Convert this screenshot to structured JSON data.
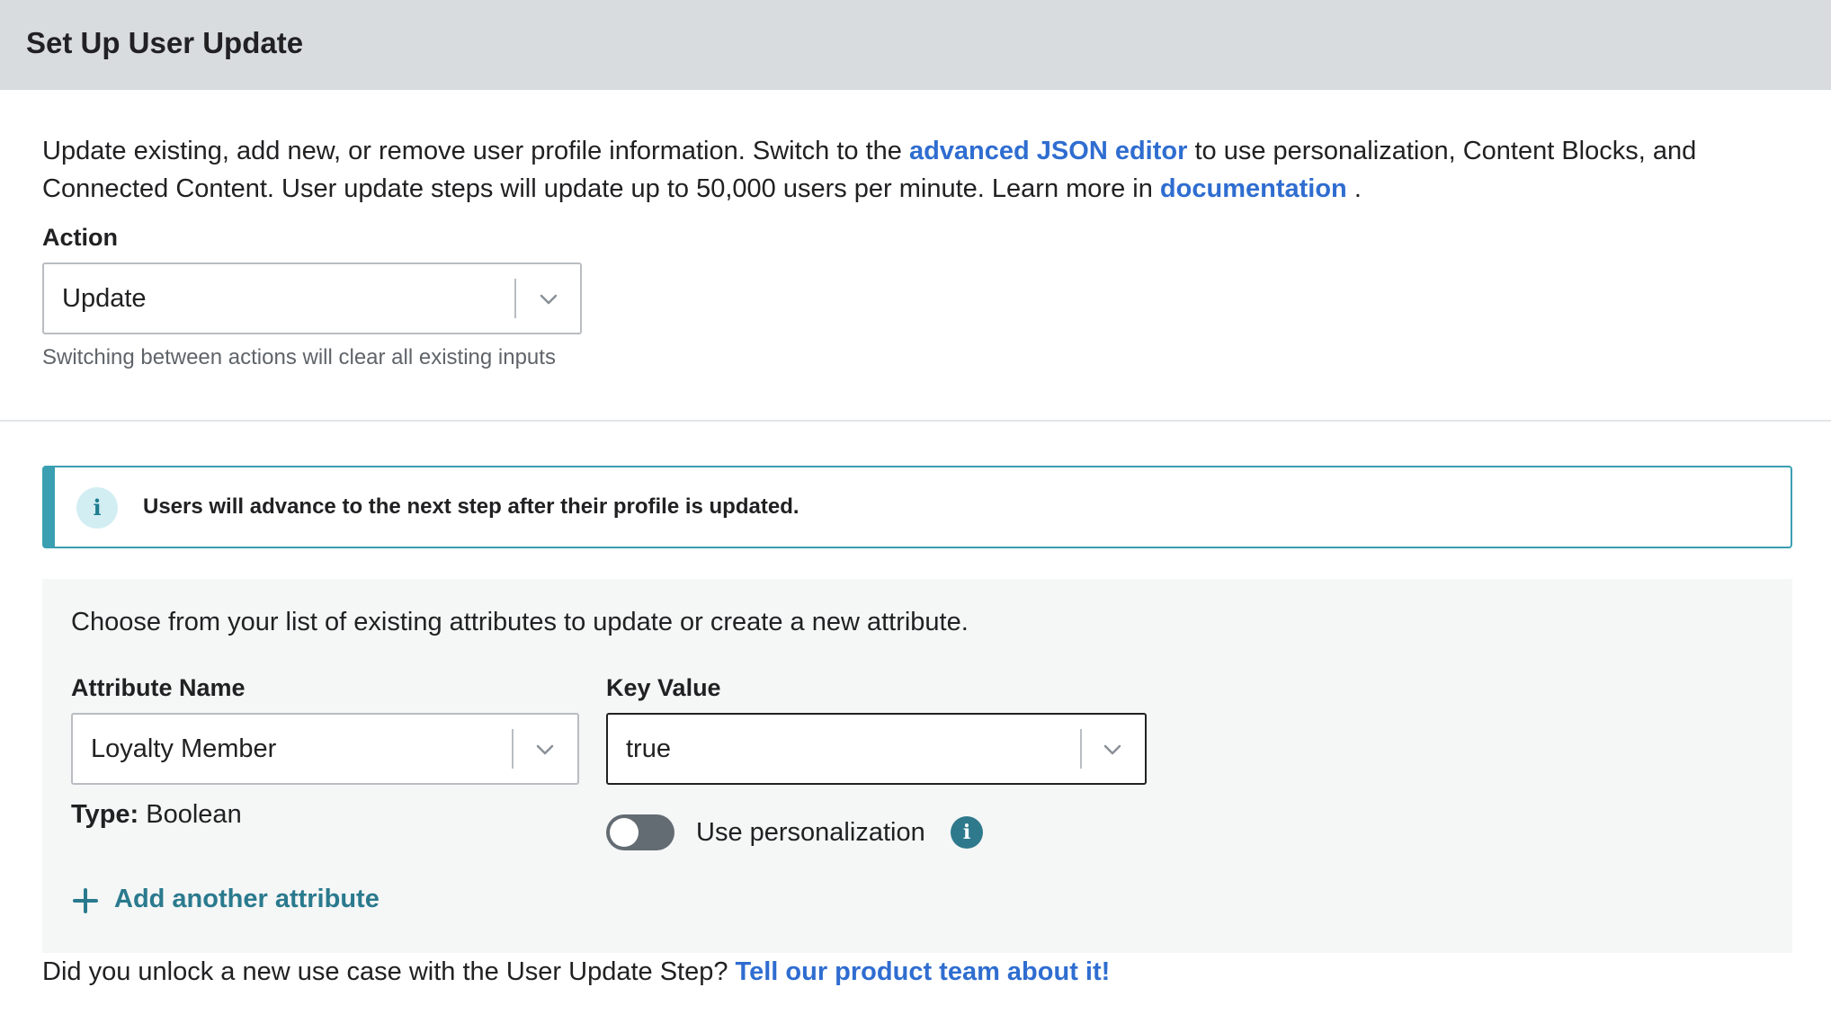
{
  "header": {
    "title": "Set Up User Update"
  },
  "intro": {
    "part1": "Update existing, add new, or remove user profile information. Switch to the ",
    "json_link": "advanced JSON editor",
    "part2": " to use personalization, Content Blocks, and Connected Content. User update steps will update up to 50,000 users per minute. Learn more in ",
    "doc_link": "documentation",
    "part3": " ."
  },
  "action": {
    "label": "Action",
    "value": "Update",
    "hint": "Switching between actions will clear all existing inputs"
  },
  "info_banner": {
    "text": "Users will advance to the next step after their profile is updated."
  },
  "attributes_panel": {
    "description": "Choose from your list of existing attributes to update or create a new attribute.",
    "attribute_name": {
      "label": "Attribute Name",
      "value": "Loyalty Member"
    },
    "key_value": {
      "label": "Key Value",
      "value": "true"
    },
    "type": {
      "label": "Type:",
      "value": "Boolean"
    },
    "personalization": {
      "label": "Use personalization",
      "enabled": false
    },
    "add_attribute": "Add another attribute"
  },
  "footer": {
    "text": "Did you unlock a new use case with the User Update Step? ",
    "link": "Tell our product team about it!"
  },
  "colors": {
    "header_bg": "#d9dcdf",
    "link": "#2f6dd0",
    "accent_teal": "#3a9fb1",
    "panel_bg": "#f5f6f6",
    "toggle_off": "#636b73"
  },
  "icons": {
    "dropdown": "chevron-down-icon",
    "info": "info-icon",
    "add": "plus-icon"
  }
}
